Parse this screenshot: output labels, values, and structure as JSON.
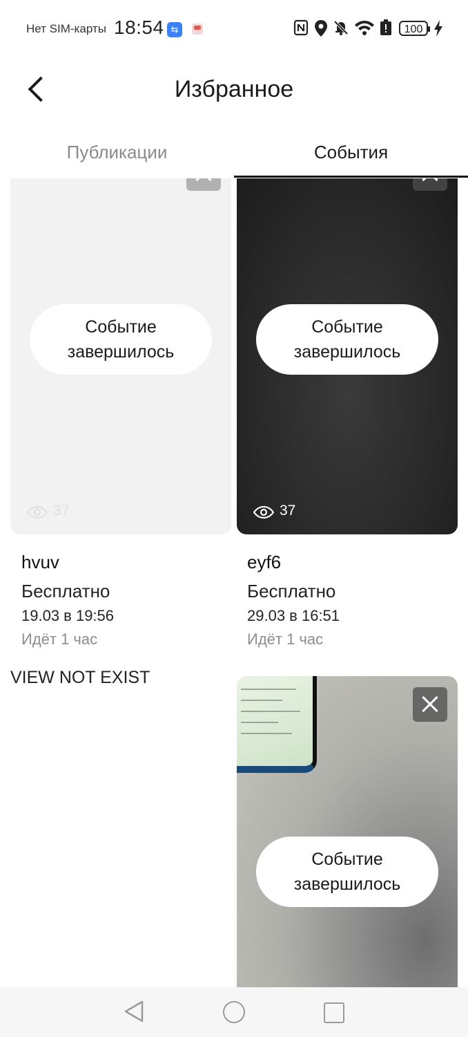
{
  "status_bar": {
    "carrier": "Нет SIM-карты",
    "time": "18:54",
    "battery": "100"
  },
  "header": {
    "title": "Избранное"
  },
  "tabs": [
    {
      "label": "Публикации",
      "active": false
    },
    {
      "label": "События",
      "active": true
    }
  ],
  "events": [
    {
      "status_line1": "Событие",
      "status_line2": "завершилось",
      "views": "37",
      "name": "hvuv",
      "price": "Бесплатно",
      "date": "19.03 в 19:56",
      "duration": "Идёт 1 час"
    },
    {
      "status_line1": "Событие",
      "status_line2": "завершилось",
      "views": "37",
      "name": "eyf6",
      "price": "Бесплатно",
      "date": "29.03 в 16:51",
      "duration": "Идёт 1 час"
    },
    {
      "status_line1": "Событие",
      "status_line2": "завершилось"
    }
  ],
  "missing_view_text": "VIEW NOT EXIST",
  "colors": {
    "accent": "#111111",
    "inactive_tab": "#8a8a8a",
    "usb_badge": "#3b82f6"
  }
}
